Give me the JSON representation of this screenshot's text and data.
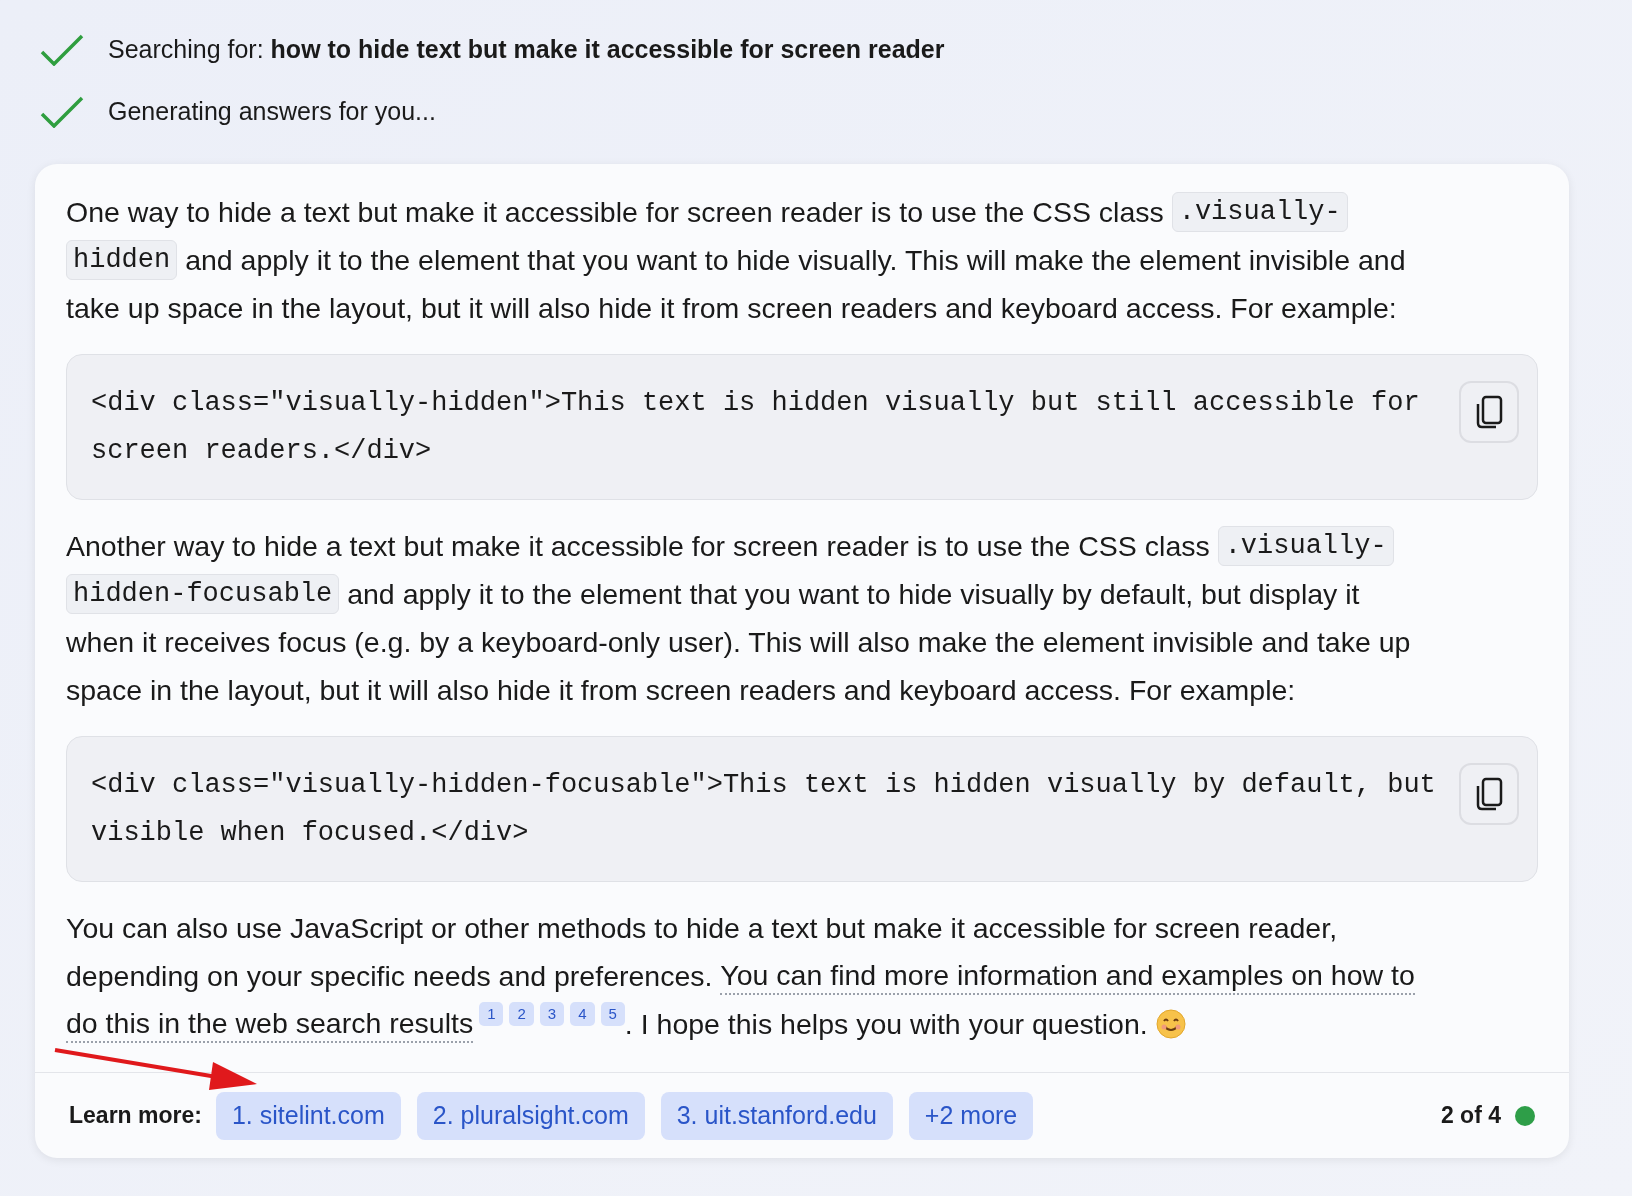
{
  "progress": [
    {
      "done": true,
      "label": "Searching for: ",
      "query": "how to hide text but make it accessible for screen reader"
    },
    {
      "done": true,
      "label": "Generating answers for you..."
    }
  ],
  "answer": [
    {
      "kind": "paragraph",
      "lines": [
        [
          {
            "kind": "text",
            "text": "One way to hide a text but make it accessible for screen reader is to use the CSS class "
          },
          {
            "kind": "code",
            "text": ".visually-"
          }
        ],
        [
          {
            "kind": "code",
            "text": "hidden"
          },
          {
            "kind": "text",
            "text": " and apply it to the element that you want to hide visually. This will make the element invisible and"
          }
        ],
        [
          {
            "kind": "text",
            "text": "take up space in the layout, but it will also hide it from screen readers and keyboard access. For example:"
          }
        ]
      ]
    },
    {
      "kind": "code_block",
      "lines": [
        "<div class=\"visually-hidden\">This text is hidden visually but still accessible for",
        "screen readers.</div>"
      ]
    },
    {
      "kind": "paragraph",
      "lines": [
        [
          {
            "kind": "text",
            "text": "Another way to hide a text but make it accessible for screen reader is to use the CSS class "
          },
          {
            "kind": "code",
            "text": ".visually-"
          }
        ],
        [
          {
            "kind": "code",
            "text": "hidden-focusable"
          },
          {
            "kind": "text",
            "text": " and apply it to the element that you want to hide visually by default, but display it"
          }
        ],
        [
          {
            "kind": "text",
            "text": "when it receives focus (e.g. by a keyboard-only user). This will also make the element invisible and take up"
          }
        ],
        [
          {
            "kind": "text",
            "text": "space in the layout, but it will also hide it from screen readers and keyboard access. For example:"
          }
        ]
      ]
    },
    {
      "kind": "code_block",
      "lines": [
        "<div class=\"visually-hidden-focusable\">This text is hidden visually by default, but",
        "visible when focused.</div>"
      ]
    },
    {
      "kind": "paragraph",
      "lines": [
        [
          {
            "kind": "text",
            "text": "You can also use JavaScript or other methods to hide a text but make it accessible for screen reader,"
          }
        ],
        [
          {
            "kind": "text",
            "text": "depending on your specific needs and preferences. "
          },
          {
            "kind": "link",
            "text": "You can find more information and examples on how to"
          }
        ],
        [
          {
            "kind": "link",
            "text": "do this in the web search results"
          },
          {
            "kind": "cite",
            "text": "1"
          },
          {
            "kind": "cite",
            "text": "2"
          },
          {
            "kind": "cite",
            "text": "3"
          },
          {
            "kind": "cite",
            "text": "4"
          },
          {
            "kind": "cite",
            "text": "5"
          },
          {
            "kind": "text",
            "text": ". I hope this helps you with your question. "
          },
          {
            "kind": "smiley"
          }
        ]
      ]
    }
  ],
  "footer": {
    "label": "Learn more:",
    "sources": [
      "1. sitelint.com",
      "2. pluralsight.com",
      "3. uit.stanford.edu",
      "+2 more"
    ],
    "page": "2 of 4"
  }
}
